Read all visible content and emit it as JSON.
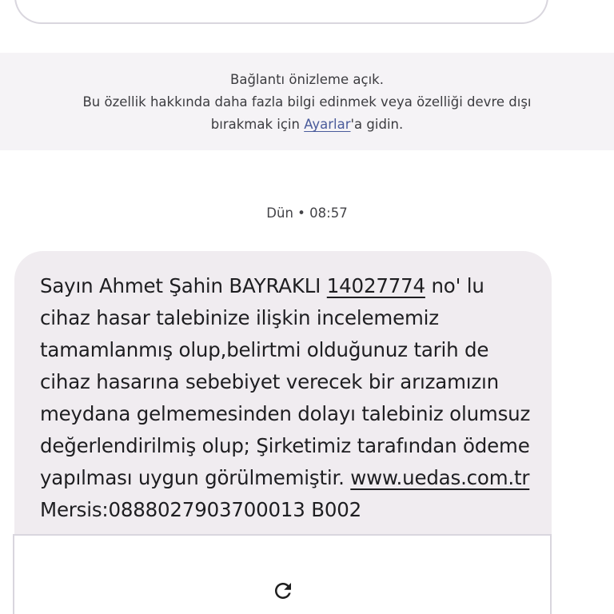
{
  "banner": {
    "line1": "Bağlantı önizleme açık.",
    "line2": "Bu özellik hakkında daha fazla bilgi edinmek veya özelliği devre dışı",
    "line3_prefix": "bırakmak için ",
    "line3_link": "Ayarlar",
    "line3_suffix": "'a gidin."
  },
  "message": {
    "timestamp": "Dün • 08:57",
    "part1": "Sayın Ahmet Şahin BAYRAKLI ",
    "number": "14027774",
    "part2": " no' lu\ncihaz hasar talebinize ilişkin incelememiz\ntamamlanmış olup,belirtmi olduğunuz tarih de\ncihaz hasarına sebebiyet verecek bir arızamızın\nmeydana gelmemesinden dolayı talebiniz olumsuz\ndeğerlendirilmiş olup; Şirketimiz tarafından ödeme\nyapılması uygun görülmemiştir. ",
    "url": "www.uedas.com.tr",
    "part3": "\nMersis:0888027903700013 B002"
  },
  "icons": {
    "refresh": "refresh-icon"
  }
}
